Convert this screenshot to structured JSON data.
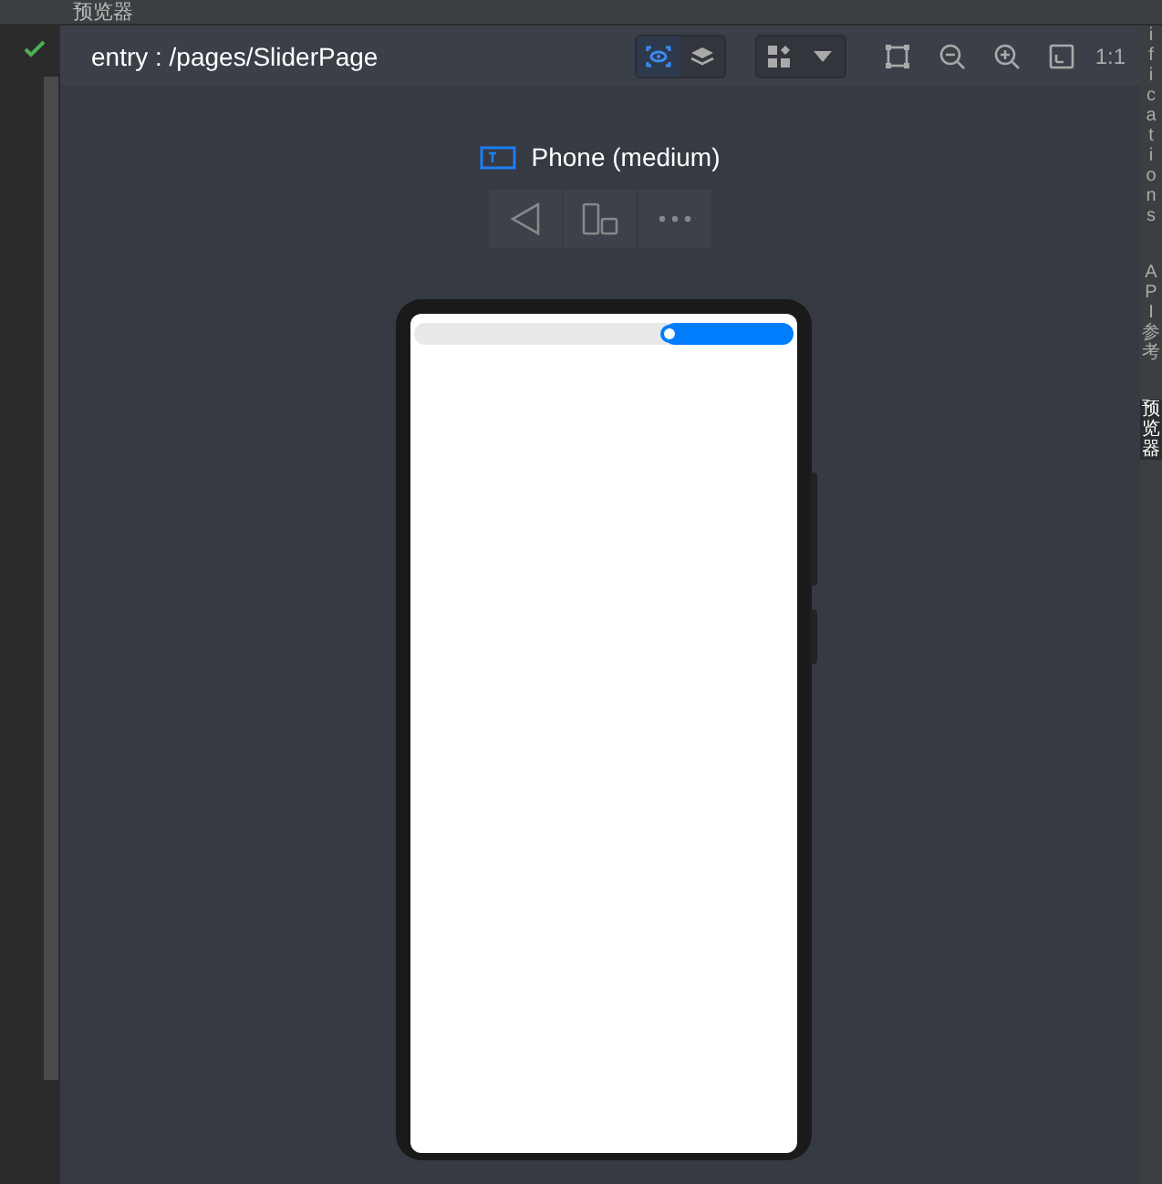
{
  "panel_title": "预览器",
  "header": {
    "path": "entry : /pages/SliderPage",
    "inspect_on": true,
    "layers_on": false,
    "zoom_label": "1:1"
  },
  "device": {
    "name": "Phone (medium)"
  },
  "side_tabs": [
    {
      "label": "ifications",
      "selected": false
    },
    {
      "label": "API参考",
      "selected": false
    },
    {
      "label": "预览器",
      "selected": true
    }
  ],
  "slider": {
    "level": 0.34
  }
}
